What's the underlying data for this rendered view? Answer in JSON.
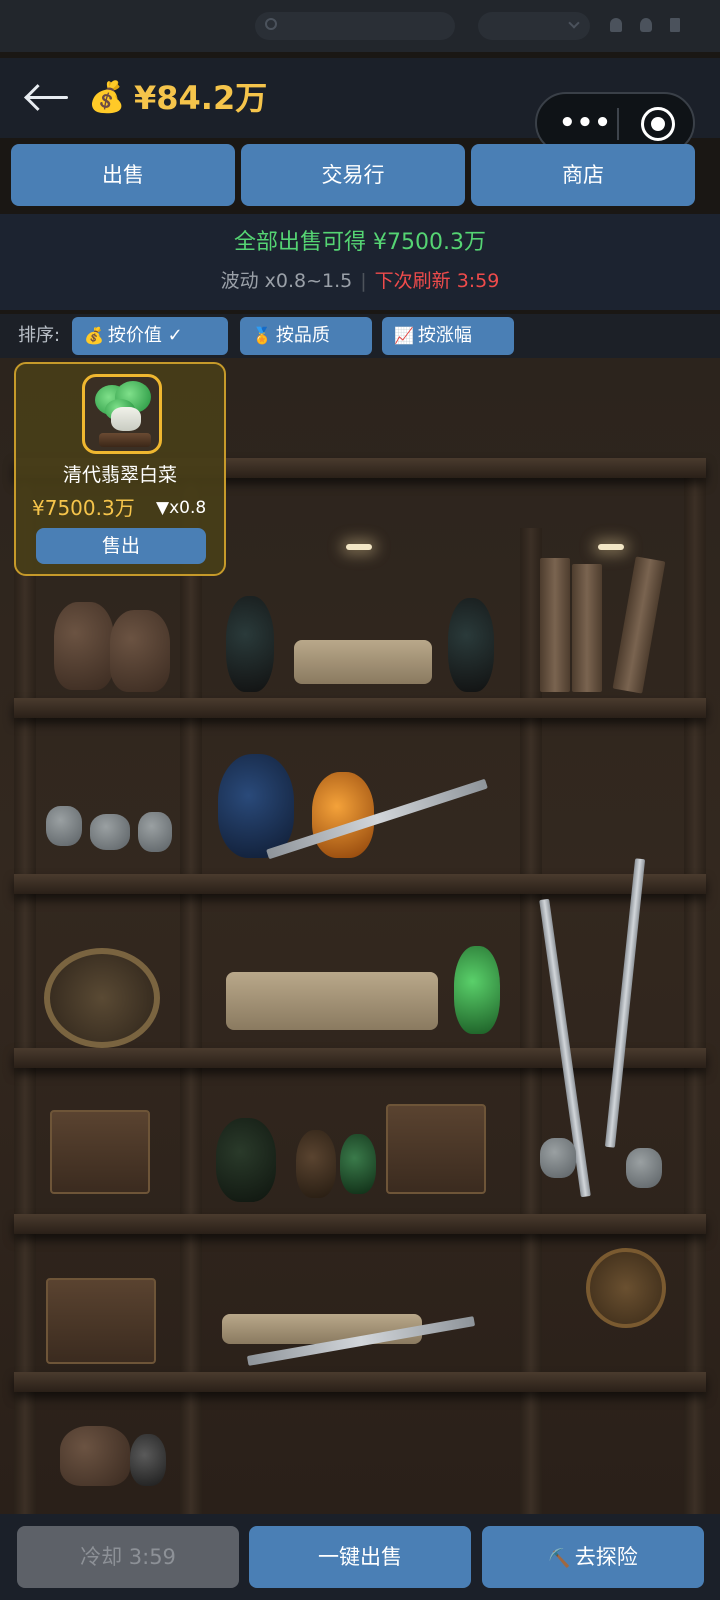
{
  "header": {
    "money_icon": "💰",
    "money": "¥84.2万",
    "capsule_more": "•••"
  },
  "tabs": [
    {
      "label": "出售"
    },
    {
      "label": "交易行"
    },
    {
      "label": "商店"
    }
  ],
  "summary": {
    "total_text": "全部出售可得 ¥7500.3万",
    "volatility": "波动 x0.8~1.5",
    "divider": "|",
    "refresh": "下次刷新 3:59"
  },
  "sort": {
    "label": "排序:",
    "options": [
      {
        "icon": "💰",
        "label": "按价值 ✓",
        "selected": true
      },
      {
        "icon": "🏅",
        "label": "按品质",
        "selected": false
      },
      {
        "icon": "📈",
        "label": "按涨幅",
        "selected": false
      }
    ]
  },
  "items": [
    {
      "name": "清代翡翠白菜",
      "price": "¥7500.3万",
      "multiplier": "▼x0.8",
      "sell_label": "售出"
    }
  ],
  "bottom": {
    "cooldown": "冷却 3:59",
    "sell_all": "一键出售",
    "explore_icon": "⛏️",
    "explore": "去探险"
  },
  "colors": {
    "accent": "#4a7fb5",
    "gold": "#f5c44b",
    "green": "#55d473",
    "red": "#ef4b4b"
  }
}
